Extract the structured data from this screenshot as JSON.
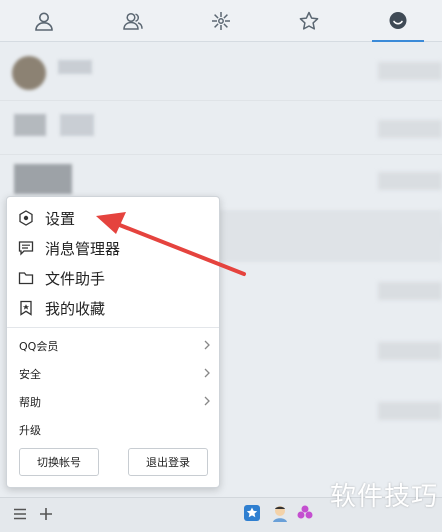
{
  "tabs": [
    {
      "icon": "contact-icon",
      "active": false
    },
    {
      "icon": "group-icon",
      "active": false
    },
    {
      "icon": "app-center-icon",
      "active": false
    },
    {
      "icon": "star-icon",
      "active": false
    },
    {
      "icon": "message-icon",
      "active": true
    }
  ],
  "menu": {
    "main_items": [
      {
        "label": "设置",
        "icon": "settings-icon"
      },
      {
        "label": "消息管理器",
        "icon": "message-manager-icon"
      },
      {
        "label": "文件助手",
        "icon": "folder-icon"
      },
      {
        "label": "我的收藏",
        "icon": "bookmark-icon"
      }
    ],
    "sub_items": [
      {
        "label": "QQ会员",
        "has_submenu": true
      },
      {
        "label": "安全",
        "has_submenu": true
      },
      {
        "label": "帮助",
        "has_submenu": true
      },
      {
        "label": "升级",
        "has_submenu": false
      }
    ],
    "switch_account": "切换帐号",
    "logout": "退出登录"
  },
  "bottom_bar": {
    "icons": [
      "hamburger-menu-icon",
      "add-icon",
      "star-badge-icon",
      "avatar-icon"
    ]
  },
  "watermark": "软件技巧",
  "colors": {
    "accent": "#3b8ad8",
    "arrow": "#e5433e"
  }
}
